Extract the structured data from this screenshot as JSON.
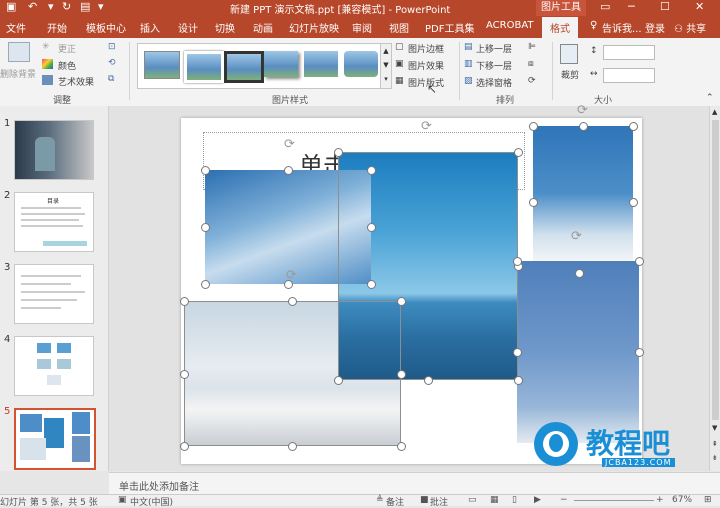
{
  "title_bar": {
    "title": "新建 PPT 演示文稿.ppt [兼容模式] - PowerPoint",
    "context_tab": "图片工具"
  },
  "menu": {
    "items": [
      "文件",
      "开始",
      "模板中心",
      "插入",
      "设计",
      "切换",
      "动画",
      "幻灯片放映",
      "审阅",
      "视图",
      "PDF工具集",
      "ACROBAT"
    ],
    "active": "格式",
    "tell_me": "告诉我...",
    "login": "登录",
    "share": "共享"
  },
  "ribbon": {
    "adjust": {
      "remove_bg": "删除背景",
      "corrections": "更正",
      "color": "颜色",
      "artistic": "艺术效果",
      "label": "调整"
    },
    "styles": {
      "label": "图片样式",
      "border": "图片边框",
      "effects": "图片效果",
      "layout": "图片版式"
    },
    "arrange": {
      "label": "排列",
      "bring_forward": "上移一层",
      "send_backward": "下移一层",
      "selection_pane": "选择窗格"
    },
    "size": {
      "label": "大小",
      "crop": "裁剪"
    }
  },
  "slides": {
    "numbers": [
      "1",
      "2",
      "3",
      "4",
      "5"
    ],
    "slide2_title": "目录",
    "selected": "5"
  },
  "canvas": {
    "title_placeholder": "单击此处添加标题"
  },
  "notes": {
    "placeholder": "单击此处添加备注"
  },
  "status": {
    "slide_info": "幻灯片 第 5 张，共 5 张",
    "language": "中文(中国)",
    "notes_btn": "备注",
    "comments_btn": "批注",
    "zoom": "67%"
  },
  "watermark": {
    "name": "教程吧",
    "url": "JCBA123.COM"
  },
  "colors": {
    "accent": "#b7472a",
    "sky": "#3f86c4",
    "sea": "#2a6ea0"
  }
}
